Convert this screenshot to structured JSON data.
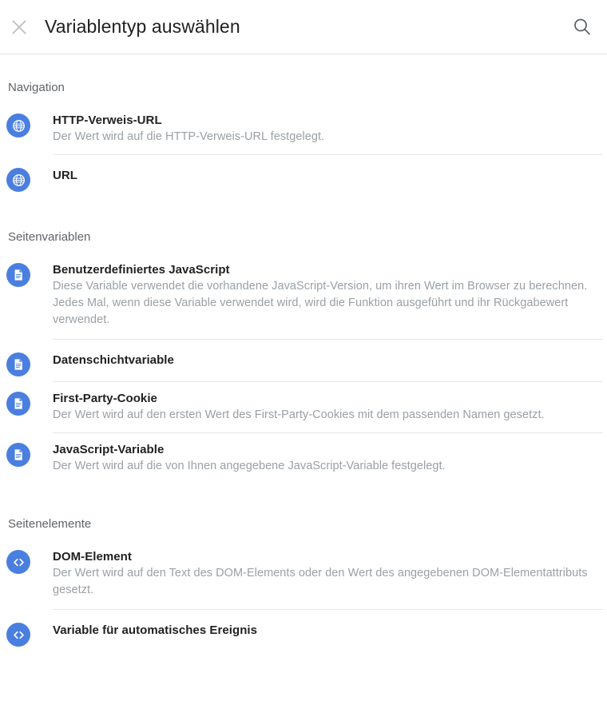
{
  "header": {
    "close_icon": "close-icon",
    "title": "Variablentyp auswählen",
    "search_icon": "search-icon"
  },
  "colors": {
    "icon_blue": "#4a7fe0",
    "title_text": "#212121",
    "description_text": "#9aa0a6",
    "section_text": "#5f6368",
    "divider": "#e6e6e6",
    "header_border": "#e0e0e0",
    "background": "#ffffff"
  },
  "sections": [
    {
      "label": "Navigation",
      "items": [
        {
          "icon": "globe-icon",
          "title": "HTTP-Verweis-URL",
          "description": "Der Wert wird auf die HTTP-Verweis-URL festgelegt."
        },
        {
          "icon": "globe-icon",
          "title": "URL",
          "description": ""
        }
      ]
    },
    {
      "label": "Seitenvariablen",
      "items": [
        {
          "icon": "document-icon",
          "title": "Benutzerdefiniertes JavaScript",
          "description": "Diese Variable verwendet die vorhandene JavaScript-Version, um ihren Wert im Browser zu berechnen. Jedes Mal, wenn diese Variable verwendet wird, wird die Funktion ausgeführt und ihr Rückgabewert verwendet."
        },
        {
          "icon": "document-icon",
          "title": "Datenschichtvariable",
          "description": ""
        },
        {
          "icon": "document-icon",
          "title": "First-Party-Cookie",
          "description": "Der Wert wird auf den ersten Wert des First-Party-Cookies mit dem passenden Namen gesetzt."
        },
        {
          "icon": "document-icon",
          "title": "JavaScript-Variable",
          "description": "Der Wert wird auf die von Ihnen angegebene JavaScript-Variable festgelegt."
        }
      ]
    },
    {
      "label": "Seitenelemente",
      "items": [
        {
          "icon": "code-icon",
          "title": "DOM-Element",
          "description": "Der Wert wird auf den Text des DOM-Elements oder den Wert des angegebenen DOM-Elementattributs gesetzt."
        },
        {
          "icon": "code-icon",
          "title": "Variable für automatisches Ereignis",
          "description": ""
        }
      ]
    }
  ]
}
